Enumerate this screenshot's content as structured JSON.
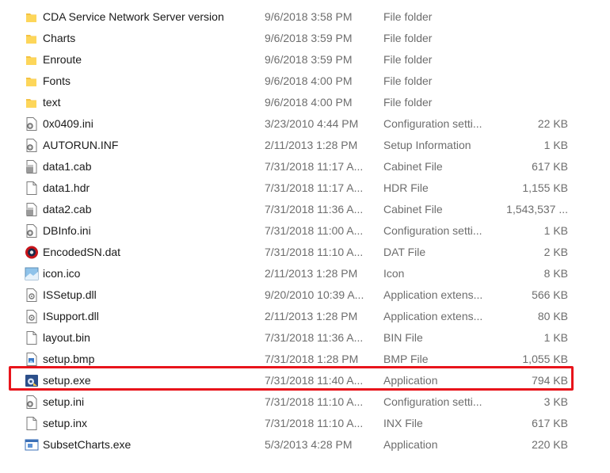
{
  "files": [
    {
      "name": "CDA Service Network Server version",
      "date": "9/6/2018 3:58 PM",
      "type": "File folder",
      "size": "",
      "icon": "folder-icon"
    },
    {
      "name": "Charts",
      "date": "9/6/2018 3:59 PM",
      "type": "File folder",
      "size": "",
      "icon": "folder-icon"
    },
    {
      "name": "Enroute",
      "date": "9/6/2018 3:59 PM",
      "type": "File folder",
      "size": "",
      "icon": "folder-icon"
    },
    {
      "name": "Fonts",
      "date": "9/6/2018 4:00 PM",
      "type": "File folder",
      "size": "",
      "icon": "folder-icon"
    },
    {
      "name": "text",
      "date": "9/6/2018 4:00 PM",
      "type": "File folder",
      "size": "",
      "icon": "folder-icon"
    },
    {
      "name": "0x0409.ini",
      "date": "3/23/2010 4:44 PM",
      "type": "Configuration setti...",
      "size": "22 KB",
      "icon": "config-file-icon"
    },
    {
      "name": "AUTORUN.INF",
      "date": "2/11/2013 1:28 PM",
      "type": "Setup Information",
      "size": "1 KB",
      "icon": "config-file-icon"
    },
    {
      "name": "data1.cab",
      "date": "7/31/2018 11:17 A...",
      "type": "Cabinet File",
      "size": "617 KB",
      "icon": "cabinet-file-icon"
    },
    {
      "name": "data1.hdr",
      "date": "7/31/2018 11:17 A...",
      "type": "HDR File",
      "size": "1,155 KB",
      "icon": "blank-file-icon"
    },
    {
      "name": "data2.cab",
      "date": "7/31/2018 11:36 A...",
      "type": "Cabinet File",
      "size": "1,543,537 ...",
      "icon": "cabinet-file-icon"
    },
    {
      "name": "DBInfo.ini",
      "date": "7/31/2018 11:00 A...",
      "type": "Configuration setti...",
      "size": "1 KB",
      "icon": "config-file-icon"
    },
    {
      "name": "EncodedSN.dat",
      "date": "7/31/2018 11:10 A...",
      "type": "DAT File",
      "size": "2 KB",
      "icon": "dat-file-icon"
    },
    {
      "name": "icon.ico",
      "date": "2/11/2013 1:28 PM",
      "type": "Icon",
      "size": "8 KB",
      "icon": "image-file-icon"
    },
    {
      "name": "ISSetup.dll",
      "date": "9/20/2010 10:39 A...",
      "type": "Application extens...",
      "size": "566 KB",
      "icon": "dll-file-icon"
    },
    {
      "name": "ISupport.dll",
      "date": "2/11/2013 1:28 PM",
      "type": "Application extens...",
      "size": "80 KB",
      "icon": "dll-file-icon"
    },
    {
      "name": "layout.bin",
      "date": "7/31/2018 11:36 A...",
      "type": "BIN File",
      "size": "1 KB",
      "icon": "blank-file-icon"
    },
    {
      "name": "setup.bmp",
      "date": "7/31/2018 1:28 PM",
      "type": "BMP File",
      "size": "1,055 KB",
      "icon": "bitmap-file-icon"
    },
    {
      "name": "setup.exe",
      "date": "7/31/2018 11:40 A...",
      "type": "Application",
      "size": "794 KB",
      "icon": "setup-exe-icon"
    },
    {
      "name": "setup.ini",
      "date": "7/31/2018 11:10 A...",
      "type": "Configuration setti...",
      "size": "3 KB",
      "icon": "config-file-icon"
    },
    {
      "name": "setup.inx",
      "date": "7/31/2018 11:10 A...",
      "type": "INX File",
      "size": "617 KB",
      "icon": "blank-file-icon"
    },
    {
      "name": "SubsetCharts.exe",
      "date": "5/3/2013 4:28 PM",
      "type": "Application",
      "size": "220 KB",
      "icon": "app-window-icon"
    }
  ],
  "colors": {
    "highlight": "#e8141b",
    "folder": "#f4c242",
    "secondary_text": "#6d6d6d"
  }
}
